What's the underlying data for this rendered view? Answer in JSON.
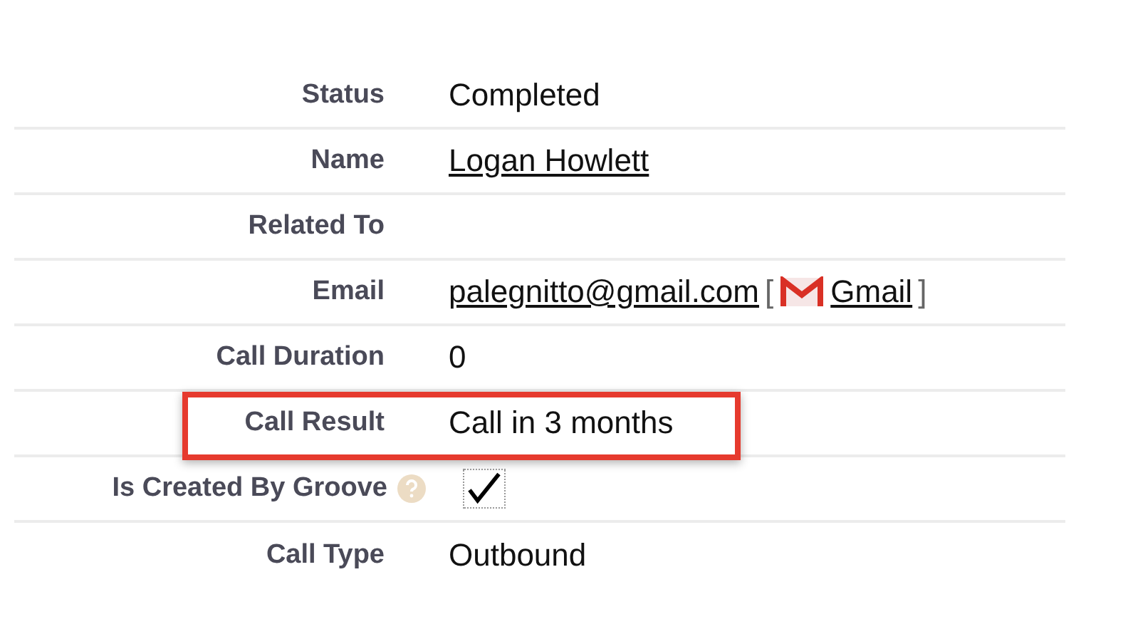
{
  "fields": [
    {
      "label": "Status",
      "kind": "text",
      "value": "Completed",
      "highlighted": false
    },
    {
      "label": "Name",
      "kind": "link",
      "value": "Logan Howlett",
      "highlighted": false
    },
    {
      "label": "Related To",
      "kind": "empty",
      "highlighted": false
    },
    {
      "label": "Email",
      "kind": "email",
      "value": "palegnitto@gmail.com",
      "bracket_open": "[",
      "link": "Gmail",
      "bracket_close": "]",
      "highlighted": false
    },
    {
      "label": "Call Duration",
      "kind": "text",
      "value": "0",
      "highlighted": false
    },
    {
      "label": "Call Result",
      "kind": "text",
      "value": "Call in 3 months",
      "highlighted": true
    },
    {
      "label": "Is Created By Groove",
      "kind": "checkbox",
      "help": true,
      "checked": true,
      "highlighted": false
    },
    {
      "label": "Call Type",
      "kind": "text",
      "value": "Outbound",
      "highlighted": false
    }
  ]
}
